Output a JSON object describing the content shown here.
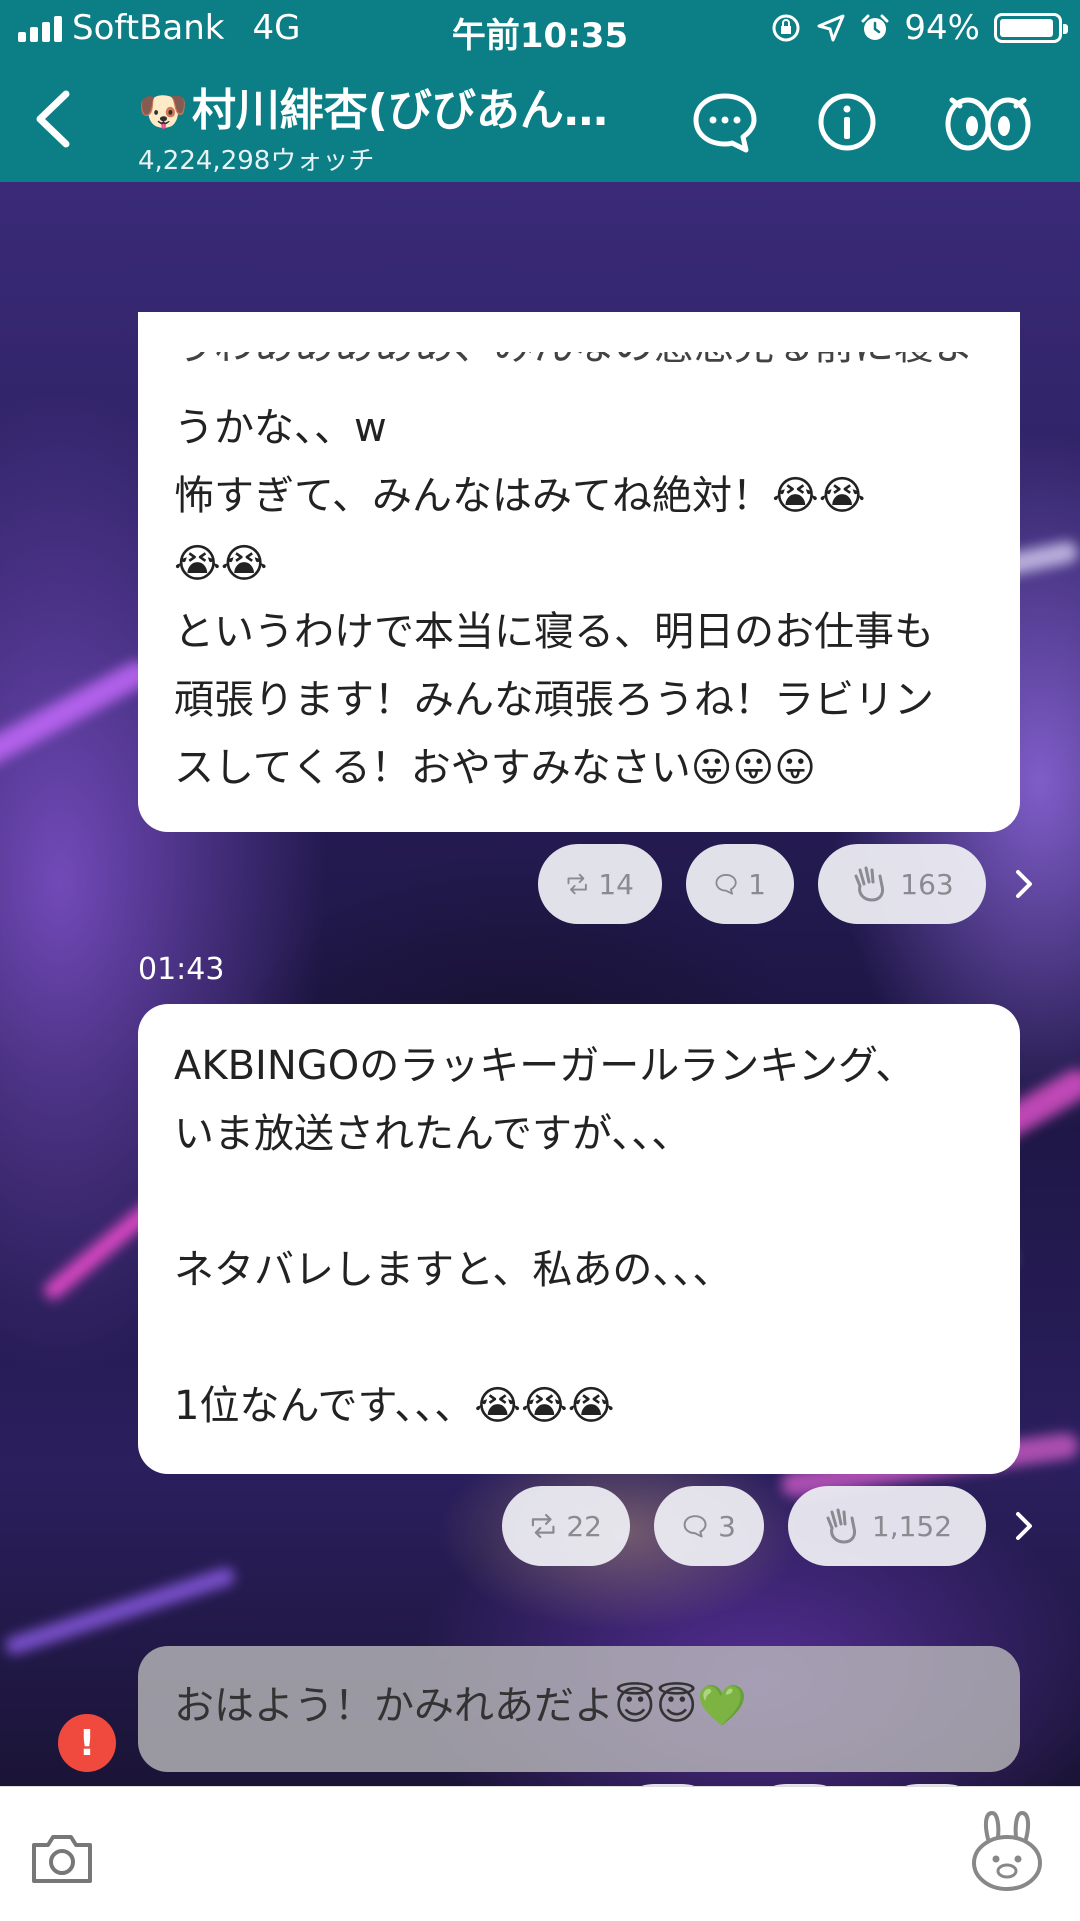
{
  "status_bar": {
    "carrier": "SoftBank",
    "network": "4G",
    "time": "午前10:35",
    "battery": "94%",
    "battery_level": 0.94
  },
  "header": {
    "title": "村川緋杏(びびあん…",
    "watch_count": "4,224,298ウォッチ",
    "icons": [
      "back-arrow-icon",
      "chat-bubble-icon",
      "info-icon",
      "watch-eyes-icon"
    ]
  },
  "posts": [
    {
      "partial_top_line": "うわあああああ、みんなの感想見る前に寝よ",
      "lines": [
        "うかな、、w",
        "怖すぎて、みんなはみてね絶対！😭😭",
        "😭😭",
        "というわけで本当に寝る、明日のお仕事も",
        "頑張ります！みんな頑張ろうね！ラビリン",
        "スしてくる！おやすみなさい😛😛😛"
      ],
      "reposts": "14",
      "comments": "1",
      "claps": "163"
    },
    {
      "timestamp": "01:43",
      "lines": [
        "AKBINGOのラッキーガールランキング、",
        "いま放送されたんですが、、、",
        "",
        "ネタバレしますと、私あの、、、",
        "",
        "1位なんです、、、😭😭😭"
      ],
      "reposts": "22",
      "comments": "3",
      "claps": "1,152"
    },
    {
      "lines": [
        "おはよう！かみれあだよ😇😇💚"
      ],
      "alert_badge": "!",
      "reposts": "",
      "comments": "",
      "claps": ""
    }
  ],
  "colors": {
    "header_bg": "#0b7e86",
    "alert": "#f04a3e"
  },
  "bottom_bar": {
    "icons": [
      "camera-icon",
      "bunny-icon"
    ]
  }
}
